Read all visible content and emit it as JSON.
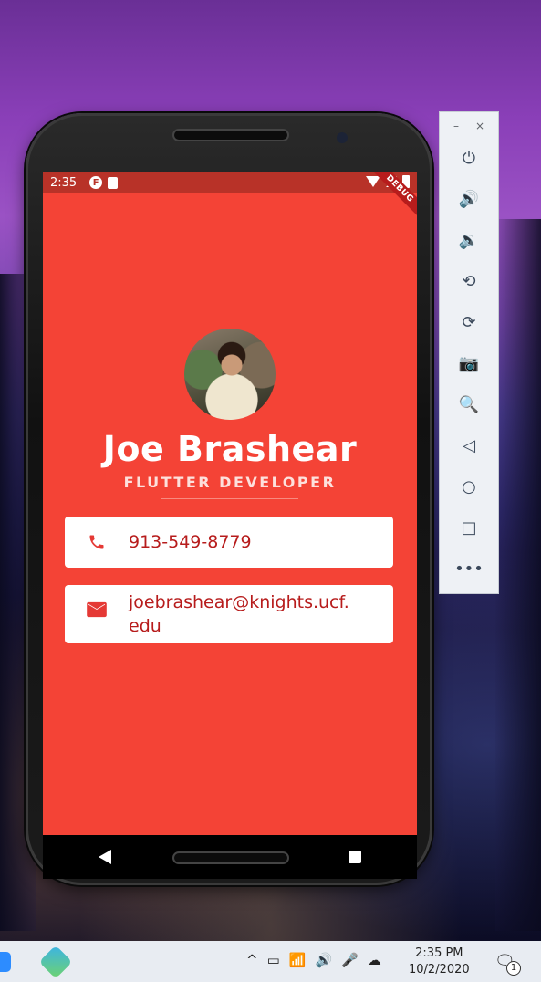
{
  "status_bar": {
    "time": "2:35",
    "debug_label": "DEBUG",
    "icons": [
      "flutter-icon",
      "sd-card-icon",
      "wifi-icon",
      "signal-icon",
      "battery-icon"
    ]
  },
  "profile": {
    "name": "Joe Brashear",
    "title": "FLUTTER DEVELOPER",
    "phone": "913-549-8779",
    "email": "joebrashear@knights.ucf.edu",
    "colors": {
      "background": "#f44336",
      "card_text": "#b71c1c",
      "card": "#ffffff"
    }
  },
  "nav_bar": {
    "buttons": [
      "back",
      "home",
      "recents"
    ]
  },
  "emulator_toolbar": {
    "window_controls": [
      "–",
      "×"
    ],
    "buttons": [
      "power",
      "volume-up",
      "volume-down",
      "rotate-left",
      "rotate-right",
      "screenshot",
      "zoom",
      "back",
      "home",
      "overview",
      "more"
    ],
    "glyphs": [
      "⏻",
      "🔊",
      "🔉",
      "⟲",
      "⟳",
      "📷",
      "🔍",
      "◁",
      "○",
      "□",
      "•••"
    ]
  },
  "taskbar": {
    "time": "2:35 PM",
    "date": "10/2/2020",
    "notification_count": "1",
    "tray_glyphs": [
      "^",
      "▭",
      "📶",
      "🔊",
      "🎤",
      "☁"
    ]
  }
}
